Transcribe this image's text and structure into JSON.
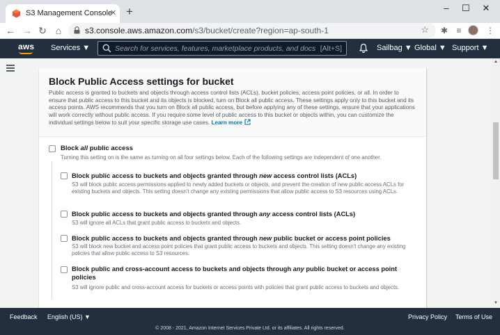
{
  "browser": {
    "tab_title": "S3 Management Console",
    "tab_close": "✕",
    "new_tab": "+",
    "window_controls": [
      "–",
      "☐",
      "✕"
    ],
    "url_host": "s3.console.aws.amazon.com",
    "url_path": "/s3/bucket/create?region=ap-south-1",
    "icons": [
      "back-icon",
      "forward-icon",
      "reload-icon",
      "lock-icon",
      "star-icon",
      "extensions-icon",
      "reading-list-icon",
      "profile-avatar",
      "menu-icon"
    ]
  },
  "aws_nav": {
    "logo": "aws",
    "services": "Services ▼",
    "search_placeholder": "Search for services, features, marketplace products, and docs",
    "search_shortcut": "[Alt+S]",
    "account": "Sailbag ▼",
    "region": "Global ▼",
    "support": "Support ▼"
  },
  "panel": {
    "title": "Block Public Access settings for bucket",
    "description": "Public access is granted to buckets and objects through access control lists (ACLs), bucket policies, access point policies, or all. In order to ensure that public access to this bucket and its objects is blocked, turn on Block all public access. These settings apply only to this bucket and its access points. AWS recommends that you turn on Block all public access, but before applying any of these settings, ensure that your applications will work correctly without public access. If you require some level of public access to this bucket or objects within, you can customize the individual settings below to suit your specific storage use cases.",
    "learn_more": "Learn more",
    "block_all": {
      "prefix": "Block ",
      "emph": "all",
      "suffix": " public access",
      "desc": "Turning this setting on is the same as turning on all four settings below. Each of the following settings are independent of one another."
    },
    "options": [
      {
        "prefix": "Block public access to buckets and objects granted through ",
        "emph": "new",
        "suffix": " access control lists (ACLs)",
        "desc": "S3 will block public access permissions applied to newly added buckets or objects, and prevent the creation of new public access ACLs for existing buckets and objects. This setting doesn't change any existing permissions that allow public access to S3 resources using ACLs."
      },
      {
        "prefix": "Block public access to buckets and objects granted through ",
        "emph": "any",
        "suffix": " access control lists (ACLs)",
        "desc": "S3 will ignore all ACLs that grant public access to buckets and objects."
      },
      {
        "prefix": "Block public access to buckets and objects granted through ",
        "emph": "new",
        "suffix": " public bucket or access point policies",
        "desc": "S3 will block new bucket and access point policies that grant public access to buckets and objects. This setting doesn't change any existing policies that allow public access to S3 resources."
      },
      {
        "prefix": "Block public and cross-account access to buckets and objects through ",
        "emph": "any",
        "suffix": " public bucket or access point policies",
        "desc": "S3 will ignore public and cross-account access for buckets or access points with policies that grant public access to buckets and objects."
      }
    ]
  },
  "footer": {
    "feedback": "Feedback",
    "language": "English (US) ▼",
    "privacy": "Privacy Policy",
    "terms": "Terms of Use",
    "copyright": "© 2008 - 2021, Amazon Internet Services Private Ltd. or its affiliates. All rights reserved."
  },
  "colors": {
    "aws_dark": "#232f3e",
    "aws_orange": "#ff9900",
    "link_blue": "#0073bb"
  }
}
